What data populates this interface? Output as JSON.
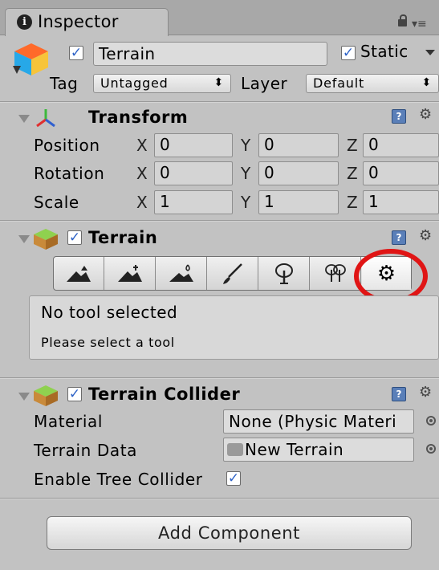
{
  "tab": {
    "label": "Inspector",
    "info_glyph": "i"
  },
  "header": {
    "name": "Terrain",
    "active": true,
    "static_label": "Static",
    "static_checked": true,
    "tag_label": "Tag",
    "tag_value": "Untagged",
    "layer_label": "Layer",
    "layer_value": "Default"
  },
  "transform": {
    "title": "Transform",
    "rows": [
      {
        "label": "Position",
        "x": "0",
        "y": "0",
        "z": "0"
      },
      {
        "label": "Rotation",
        "x": "0",
        "y": "0",
        "z": "0"
      },
      {
        "label": "Scale",
        "x": "1",
        "y": "1",
        "z": "1"
      }
    ],
    "axes": {
      "x": "X",
      "y": "Y",
      "z": "Z"
    }
  },
  "terrain": {
    "title": "Terrain",
    "enabled": true,
    "tools": [
      "raise-lower-terrain-icon",
      "paint-height-icon",
      "smooth-height-icon",
      "paint-texture-icon",
      "place-trees-icon",
      "paint-details-icon",
      "terrain-settings-icon"
    ],
    "selected_tool": "terrain-settings-icon",
    "message_title": "No tool selected",
    "message_body": "Please select a tool"
  },
  "collider": {
    "title": "Terrain Collider",
    "enabled": true,
    "material_label": "Material",
    "material_value": "None (Physic Materi",
    "terrain_data_label": "Terrain Data",
    "terrain_data_value": "New Terrain",
    "tree_collider_label": "Enable Tree Collider",
    "tree_collider_checked": true
  },
  "add_component_label": "Add Component",
  "colors": {
    "annotation": "#e01515",
    "panel": "#c2c2c2",
    "check": "#2e63c7"
  }
}
